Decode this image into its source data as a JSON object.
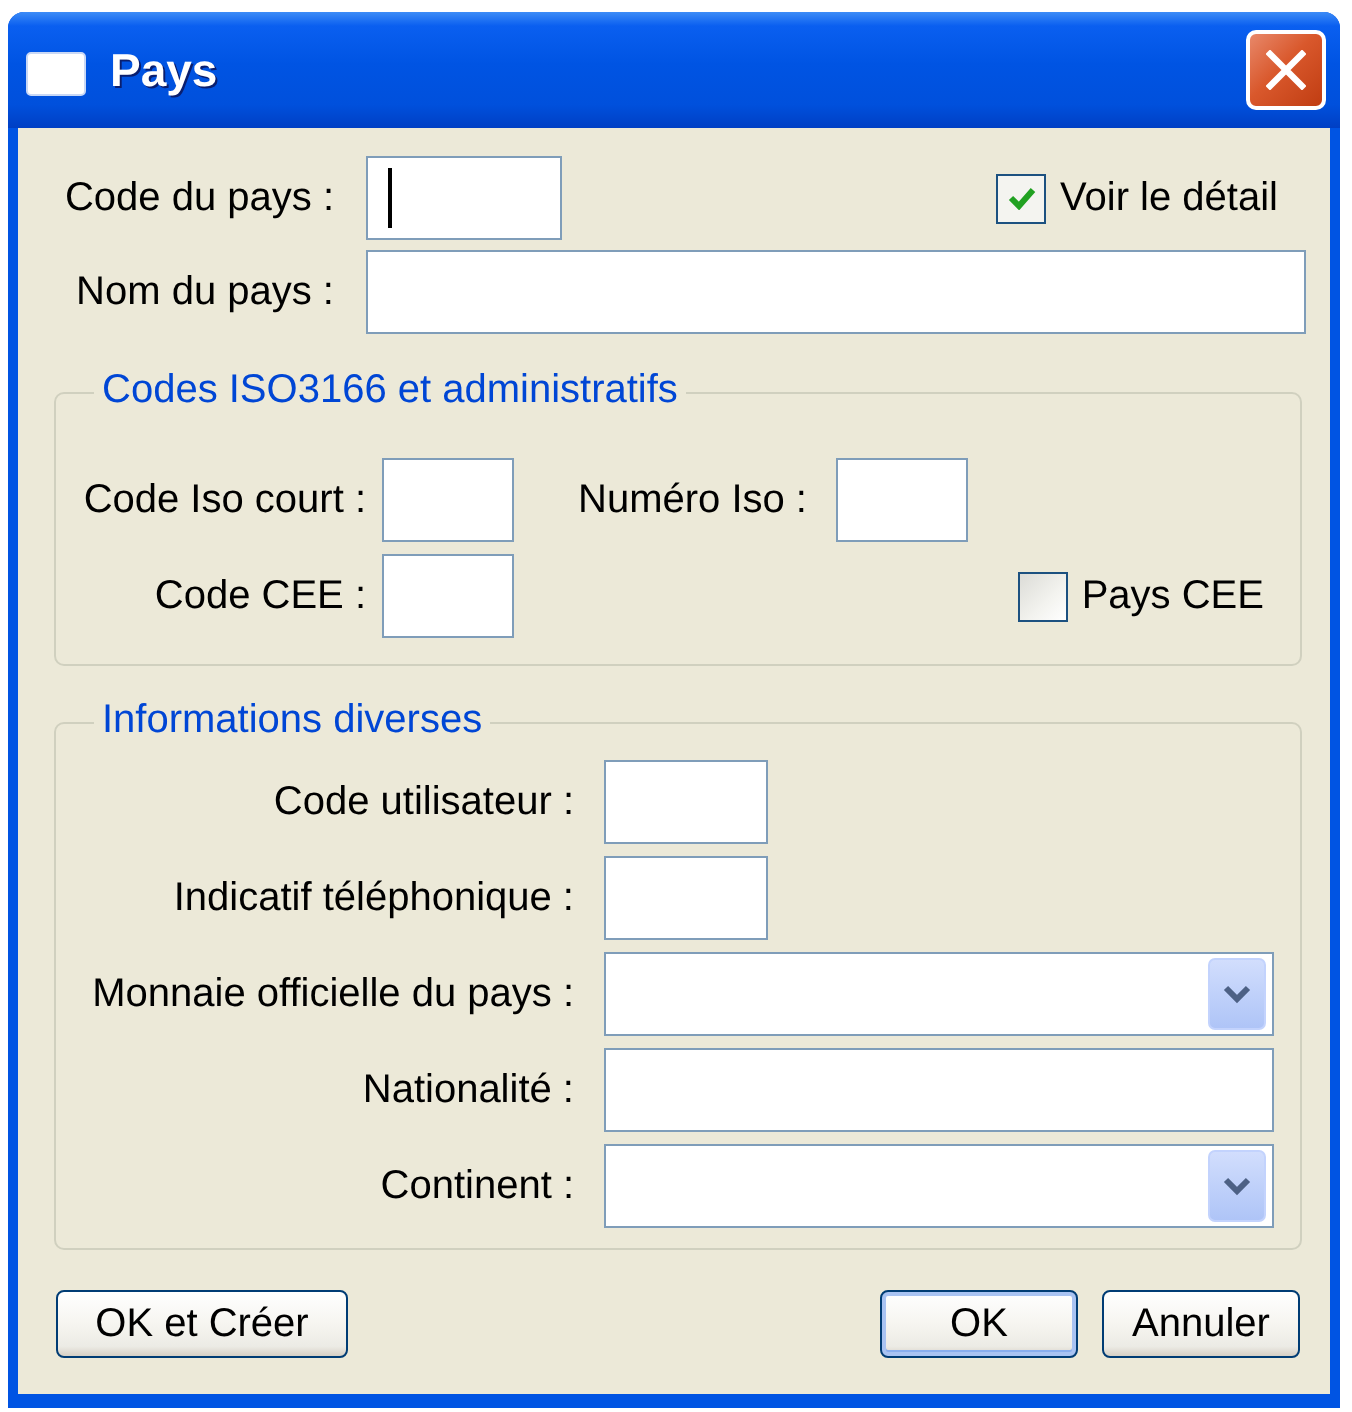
{
  "window": {
    "title": "Pays"
  },
  "sections": [
    {
      "kind": "plain",
      "rows": [
        [
          {
            "kind": "short",
            "label": "Code du pays :",
            "focused": true
          },
          {
            "kind": "checkbox",
            "label": "Voir le détail",
            "checked": true
          }
        ],
        [
          {
            "kind": "text",
            "label": "Nom du pays :",
            "focused": false
          }
        ]
      ]
    },
    {
      "kind": "group",
      "title": "Codes ISO3166 et administratifs",
      "rows": [
        [
          {
            "kind": "short",
            "label": "Code Iso court :",
            "focused": false
          },
          {
            "kind": "short",
            "label": "Numéro Iso :",
            "focused": false
          }
        ],
        [
          {
            "kind": "short",
            "label": "Code CEE :",
            "focused": false
          },
          {
            "kind": "checkbox",
            "label": "Pays CEE",
            "checked": false
          }
        ]
      ]
    },
    {
      "kind": "group",
      "title": "Informations diverses",
      "rows": [
        [
          {
            "kind": "short",
            "label": "Code utilisateur :",
            "focused": false
          }
        ],
        [
          {
            "kind": "short",
            "label": "Indicatif téléphonique :",
            "focused": false
          }
        ],
        [
          {
            "kind": "combo",
            "label": "Monnaie officielle du pays :",
            "focused": false
          }
        ],
        [
          {
            "kind": "text",
            "label": "Nationalité :",
            "focused": false
          }
        ],
        [
          {
            "kind": "combo",
            "label": "Continent :",
            "focused": false
          }
        ]
      ]
    }
  ],
  "buttons": [
    {
      "label": "OK et Créer",
      "default": false
    },
    {
      "label": "OK",
      "default": true
    },
    {
      "label": "Annuler",
      "default": false
    }
  ]
}
